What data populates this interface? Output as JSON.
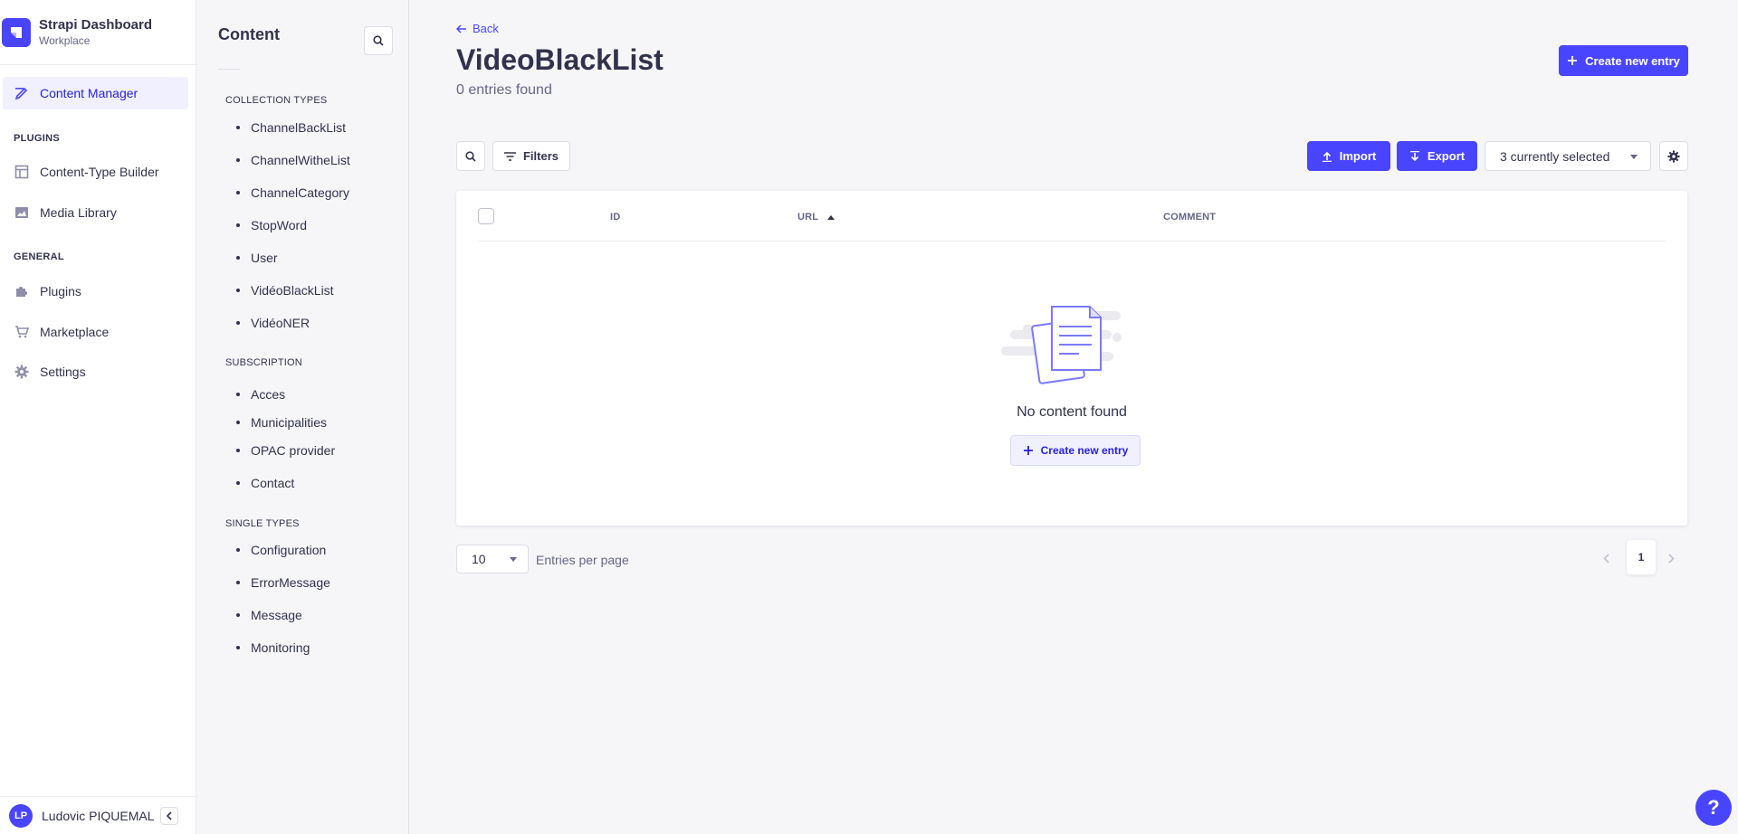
{
  "brand": {
    "title": "Strapi Dashboard",
    "subtitle": "Workplace",
    "logo_icon": "strapi-logo"
  },
  "mainnav": {
    "items": [
      {
        "label": "Content Manager",
        "icon": "feather-icon",
        "active": true
      },
      {
        "label": "Content-Type Builder",
        "icon": "layout-icon"
      },
      {
        "label": "Media Library",
        "icon": "picture-icon"
      },
      {
        "label": "Plugins",
        "icon": "puzzle-icon"
      },
      {
        "label": "Marketplace",
        "icon": "cart-icon"
      },
      {
        "label": "Settings",
        "icon": "gear-icon"
      }
    ],
    "sections": {
      "plugins": "PLUGINS",
      "general": "GENERAL"
    }
  },
  "user": {
    "initials": "LP",
    "name": "Ludovic PIQUEMAL"
  },
  "subnav": {
    "title": "Content",
    "collection_types_label": "COLLECTION TYPES",
    "collection_types": [
      "ChannelBackList",
      "ChannelWitheList",
      "ChannelCategory",
      "StopWord",
      "User",
      "VidéoBlackList",
      "VidéoNER"
    ],
    "subscription_label": "SUBSCRIPTION",
    "subscription": [
      "Acces",
      "Municipalities",
      "OPAC provider",
      "Contact"
    ],
    "single_types_label": "SINGLE TYPES",
    "single_types": [
      "Configuration",
      "ErrorMessage",
      "Message",
      "Monitoring"
    ]
  },
  "header": {
    "back_label": "Back",
    "title": "VideoBlackList",
    "entries_found": "0 entries found",
    "create_label": "Create new entry"
  },
  "toolbar": {
    "filters_label": "Filters",
    "import_label": "Import",
    "export_label": "Export",
    "columns_selected": "3 currently selected"
  },
  "table": {
    "columns": [
      "ID",
      "URL",
      "COMMENT"
    ],
    "empty_text": "No content found",
    "empty_create_label": "Create new entry"
  },
  "pagination": {
    "per_page": "10",
    "per_page_label": "Entries per page",
    "current_page": "1"
  },
  "help": {
    "label": "?"
  },
  "colors": {
    "primary": "#4945ff",
    "text": "#32324d",
    "muted": "#666687",
    "background": "#f6f6f9"
  }
}
